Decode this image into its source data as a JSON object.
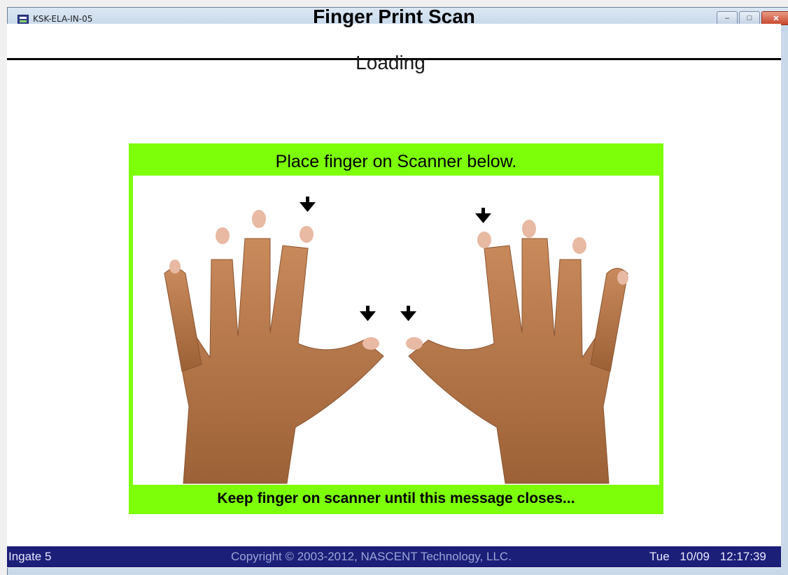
{
  "window": {
    "title": "KSK-ELA-IN-05",
    "buttons": {
      "minimize_icon": "minimize-icon",
      "maximize_icon": "maximize-icon",
      "close_icon": "close-icon"
    }
  },
  "header": {
    "title": "Finger Print Scan"
  },
  "status": {
    "text": "Loading"
  },
  "scan_panel": {
    "instruction": "Place finger on Scanner below.",
    "footer_message": "Keep finger on scanner until this message closes...",
    "accent_color": "#7dff0a"
  },
  "statusbar": {
    "location": "Ingate 5",
    "copyright": "Copyright © 2003-2012, NASCENT Technology, LLC.",
    "day": "Tue",
    "date": "10/09",
    "time": "12:17:39",
    "background_color": "#1b1f78"
  }
}
